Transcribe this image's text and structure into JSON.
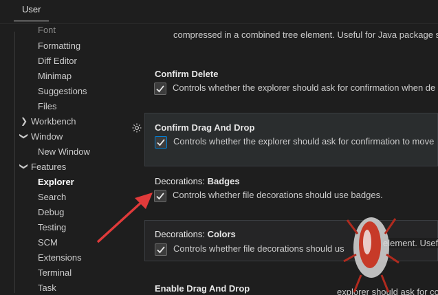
{
  "header": {
    "tab_user": "User"
  },
  "sidebar": {
    "items": [
      {
        "label": "Font"
      },
      {
        "label": "Formatting"
      },
      {
        "label": "Diff Editor"
      },
      {
        "label": "Minimap"
      },
      {
        "label": "Suggestions"
      },
      {
        "label": "Files"
      },
      {
        "label": "Workbench"
      },
      {
        "label": "Window"
      },
      {
        "label": "New Window"
      },
      {
        "label": "Features"
      },
      {
        "label": "Explorer"
      },
      {
        "label": "Search"
      },
      {
        "label": "Debug"
      },
      {
        "label": "Testing"
      },
      {
        "label": "SCM"
      },
      {
        "label": "Extensions"
      },
      {
        "label": "Terminal"
      },
      {
        "label": "Task"
      }
    ]
  },
  "settings": {
    "top_desc": "compressed in a combined tree element. Useful for Java package st",
    "confirm_delete": {
      "title": "Confirm Delete",
      "desc": "Controls whether the explorer should ask for confirmation when de"
    },
    "confirm_drag": {
      "title": "Confirm Drag And Drop",
      "desc": "Controls whether the explorer should ask for confirmation to move"
    },
    "badges": {
      "title_prefix": "Decorations: ",
      "title_bold": "Badges",
      "desc": "Controls whether file decorations should use badges."
    },
    "colors": {
      "title_prefix": "Decorations: ",
      "title_bold": "Colors",
      "desc": "Controls whether file decorations should us",
      "overlay": "tree element. Useful"
    },
    "enable_drag": {
      "title": "Enable Drag And Drop",
      "overlay": "explorer should ask for co"
    }
  },
  "colors": {
    "accent": "#007fd4",
    "arrow": "#e03a3a",
    "background": "#1e1e1e"
  }
}
